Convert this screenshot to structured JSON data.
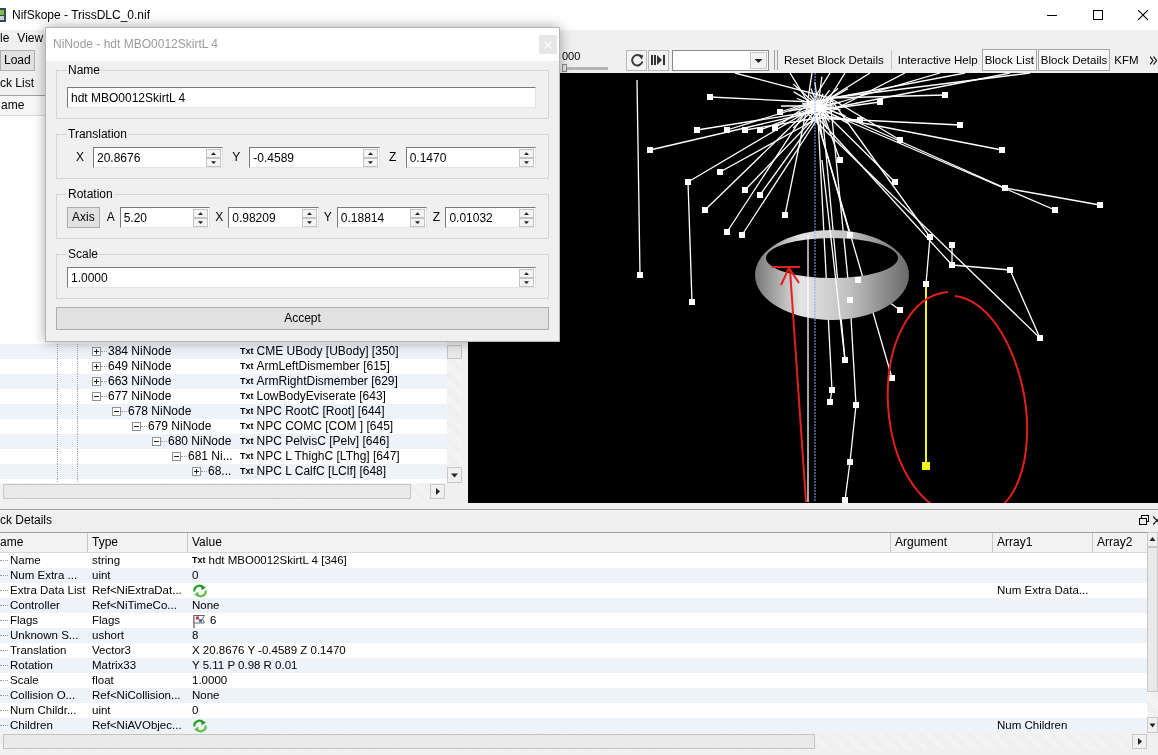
{
  "window": {
    "title": "NifSkope - TrissDLC_0.nif"
  },
  "menu": [
    "le",
    "View"
  ],
  "toolbar": {
    "left_buttons": [
      "Load"
    ],
    "slider": {
      "label": "000",
      "level": 0
    },
    "buttons": [
      {
        "label": "Reset Block Details",
        "checked": false
      },
      {
        "label": "Interactive Help",
        "checked": false
      },
      {
        "label": "Block List",
        "checked": true
      },
      {
        "label": "Block Details",
        "checked": true
      },
      {
        "label": "KFM",
        "checked": false
      }
    ]
  },
  "block_list": {
    "title": "ck List",
    "columns": [
      "ame"
    ],
    "rows": [
      {
        "label": "384 NiNode",
        "tag": "Txt",
        "value": "CME UBody [UBody] [350]",
        "expanded": false,
        "selected": false
      },
      {
        "label": "649 NiNode",
        "tag": "Txt",
        "value": "ArmLeftDismember [615]",
        "expanded": false,
        "selected": false
      },
      {
        "label": "663 NiNode",
        "tag": "Txt",
        "value": "ArmRightDismember [629]",
        "expanded": false,
        "selected": false
      },
      {
        "label": "677 NiNode",
        "tag": "Txt",
        "value": "LowBodyEviserate [643]",
        "expanded": true,
        "selected": false,
        "children": [
          {
            "label": "678 NiNode",
            "tag": "Txt",
            "value": "NPC RootC [Root] [644]",
            "expanded": true,
            "selected": false,
            "children": [
              {
                "label": "679 NiNode",
                "tag": "Txt",
                "value": "NPC COMC [COM ] [645]",
                "expanded": true,
                "selected": false,
                "children": [
                  {
                    "label": "680 NiNode",
                    "tag": "Txt",
                    "value": "NPC PelvisC [Pelv] [646]",
                    "expanded": true,
                    "selected": false,
                    "children": [
                      {
                        "label": "681 Ni...",
                        "tag": "Txt",
                        "value": "NPC L ThighC [LThg] [647]",
                        "expanded": true,
                        "selected": false,
                        "children": [
                          {
                            "label": "68...",
                            "tag": "Txt",
                            "value": "NPC L CalfC [LClf] [648]",
                            "expanded": false,
                            "selected": false
                          }
                        ]
                      }
                    ]
                  }
                ]
              }
            ]
          }
        ]
      }
    ]
  },
  "dialog": {
    "title": "NiNode - hdt MBO0012SkirtL 4",
    "groups": [
      {
        "title": "Name",
        "kind": "text",
        "value": "hdt MBO0012SkirtL 4"
      },
      {
        "title": "Translation",
        "kind": "spin",
        "fields": [
          {
            "label": "X",
            "value": "20.8676"
          },
          {
            "label": "Y",
            "value": "-0.4589"
          },
          {
            "label": "Z",
            "value": "0.1470"
          }
        ]
      },
      {
        "title": "Rotation",
        "kind": "spin",
        "button": "Axis",
        "fields": [
          {
            "label": "A",
            "value": "5.20"
          },
          {
            "label": "X",
            "value": "0.98209"
          },
          {
            "label": "Y",
            "value": "0.18814"
          },
          {
            "label": "Z",
            "value": "0.01032"
          }
        ]
      },
      {
        "title": "Scale",
        "kind": "spin",
        "fields": [
          {
            "value": "1.0000"
          }
        ]
      }
    ],
    "accept": "Accept"
  },
  "block_details": {
    "title": "ck Details",
    "columns": [
      "ame",
      "Type",
      "Value",
      "Argument",
      "Array1",
      "Array2"
    ],
    "rows": [
      {
        "name": "Name",
        "type": "string",
        "kind": "string",
        "tag": "Txt",
        "value": "hdt MBO0012SkirtL 4 [346]",
        "selected": false
      },
      {
        "name": "Num Extra ...",
        "type": "uint",
        "kind": "plain",
        "value": "0",
        "selected": false
      },
      {
        "name": "Extra Data List",
        "type": "Ref<NiExtraDat...",
        "kind": "array",
        "array1": "Num Extra Data...",
        "selected": false
      },
      {
        "name": "Controller",
        "type": "Ref<NiTimeCo...",
        "kind": "plain",
        "value": "None",
        "selected": false
      },
      {
        "name": "Flags",
        "type": "Flags",
        "kind": "flags",
        "value": "6",
        "selected": false
      },
      {
        "name": "Unknown S...",
        "type": "ushort",
        "kind": "plain",
        "value": "8",
        "selected": false
      },
      {
        "name": "Translation",
        "type": "Vector3",
        "kind": "plain",
        "value": "X 20.8676 Y -0.4589 Z 0.1470",
        "selected": false
      },
      {
        "name": "Rotation",
        "type": "Matrix33",
        "kind": "plain",
        "value": "Y 5.11 P 0.98 R 0.01",
        "selected": false
      },
      {
        "name": "Scale",
        "type": "float",
        "kind": "plain",
        "value": "1.0000",
        "selected": false
      },
      {
        "name": "Collision O...",
        "type": "Ref<NiCollision...",
        "kind": "plain",
        "value": "None",
        "selected": false
      },
      {
        "name": "Num Childr...",
        "type": "uint",
        "kind": "plain",
        "value": "0",
        "selected": false
      },
      {
        "name": "Children",
        "type": "Ref<NiAVObjec...",
        "kind": "array",
        "array1": "Num Children",
        "selected": false
      }
    ]
  }
}
